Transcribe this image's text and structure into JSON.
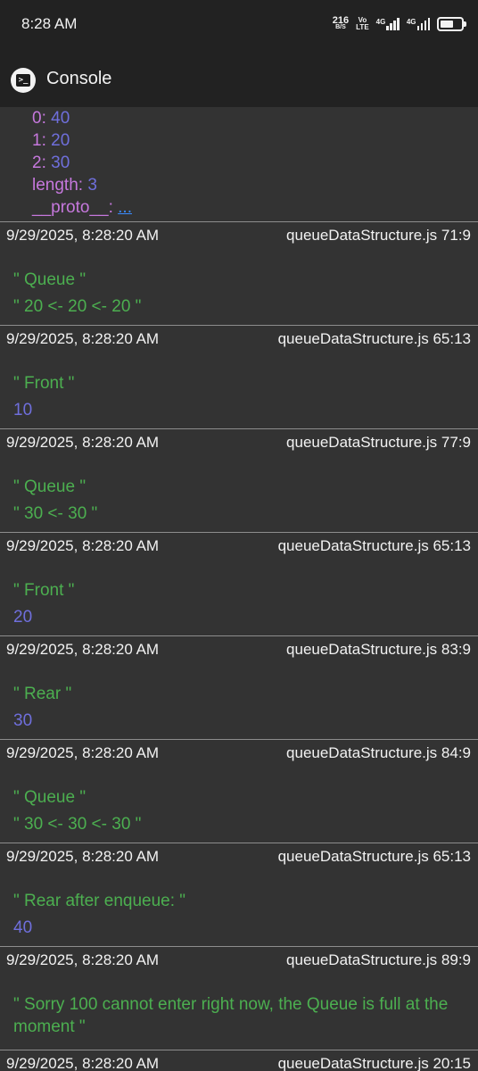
{
  "status_bar": {
    "time": "8:28 AM",
    "speed_value": "216",
    "speed_unit": "B/S",
    "volte_top": "Vo",
    "volte_bottom": "LTE",
    "net1": "4G",
    "net2": "4G",
    "battery_level": 0.52
  },
  "app_bar": {
    "title": "Console"
  },
  "object": {
    "rows": [
      {
        "key": "0:",
        "value": "40"
      },
      {
        "key": "1:",
        "value": "20"
      },
      {
        "key": "2:",
        "value": "30"
      },
      {
        "key": "length:",
        "value": "3"
      },
      {
        "key": "__proto__:",
        "value": "..."
      }
    ]
  },
  "entries": [
    {
      "timestamp": "9/29/2025, 8:28:20 AM",
      "source": "queueDataStructure.js 71:9",
      "line1": "\" Queue \"",
      "line2": "\" 20 <- 20 <- 20 \"",
      "line2_type": "string"
    },
    {
      "timestamp": "9/29/2025, 8:28:20 AM",
      "source": "queueDataStructure.js 65:13",
      "line1": "\" Front \"",
      "line2": "10",
      "line2_type": "number"
    },
    {
      "timestamp": "9/29/2025, 8:28:20 AM",
      "source": "queueDataStructure.js 77:9",
      "line1": "\" Queue \"",
      "line2": "\" 30 <- 30 \"",
      "line2_type": "string"
    },
    {
      "timestamp": "9/29/2025, 8:28:20 AM",
      "source": "queueDataStructure.js 65:13",
      "line1": "\" Front \"",
      "line2": "20",
      "line2_type": "number"
    },
    {
      "timestamp": "9/29/2025, 8:28:20 AM",
      "source": "queueDataStructure.js 83:9",
      "line1": "\" Rear \"",
      "line2": "30",
      "line2_type": "number"
    },
    {
      "timestamp": "9/29/2025, 8:28:20 AM",
      "source": "queueDataStructure.js 84:9",
      "line1": "\" Queue \"",
      "line2": "\" 30 <- 30 <- 30 \"",
      "line2_type": "string"
    },
    {
      "timestamp": "9/29/2025, 8:28:20 AM",
      "source": "queueDataStructure.js 65:13",
      "line1": "\" Rear after enqueue: \"",
      "line2": "40",
      "line2_type": "number"
    },
    {
      "timestamp": "9/29/2025, 8:28:20 AM",
      "source": "queueDataStructure.js 89:9",
      "line1": "\" Sorry 100 cannot enter right now, the Queue is full at the moment \"",
      "line2": "",
      "line2_type": "none"
    },
    {
      "timestamp": "9/29/2025, 8:28:20 AM",
      "source": "queueDataStructure.js 20:15",
      "line1": "",
      "line2": "",
      "line2_type": "none"
    }
  ],
  "colors": {
    "string": "#4caf50",
    "number": "#6f6fdc",
    "key": "#c678dd",
    "link": "#3a8bff",
    "background": "#333333",
    "bar": "#222222"
  }
}
